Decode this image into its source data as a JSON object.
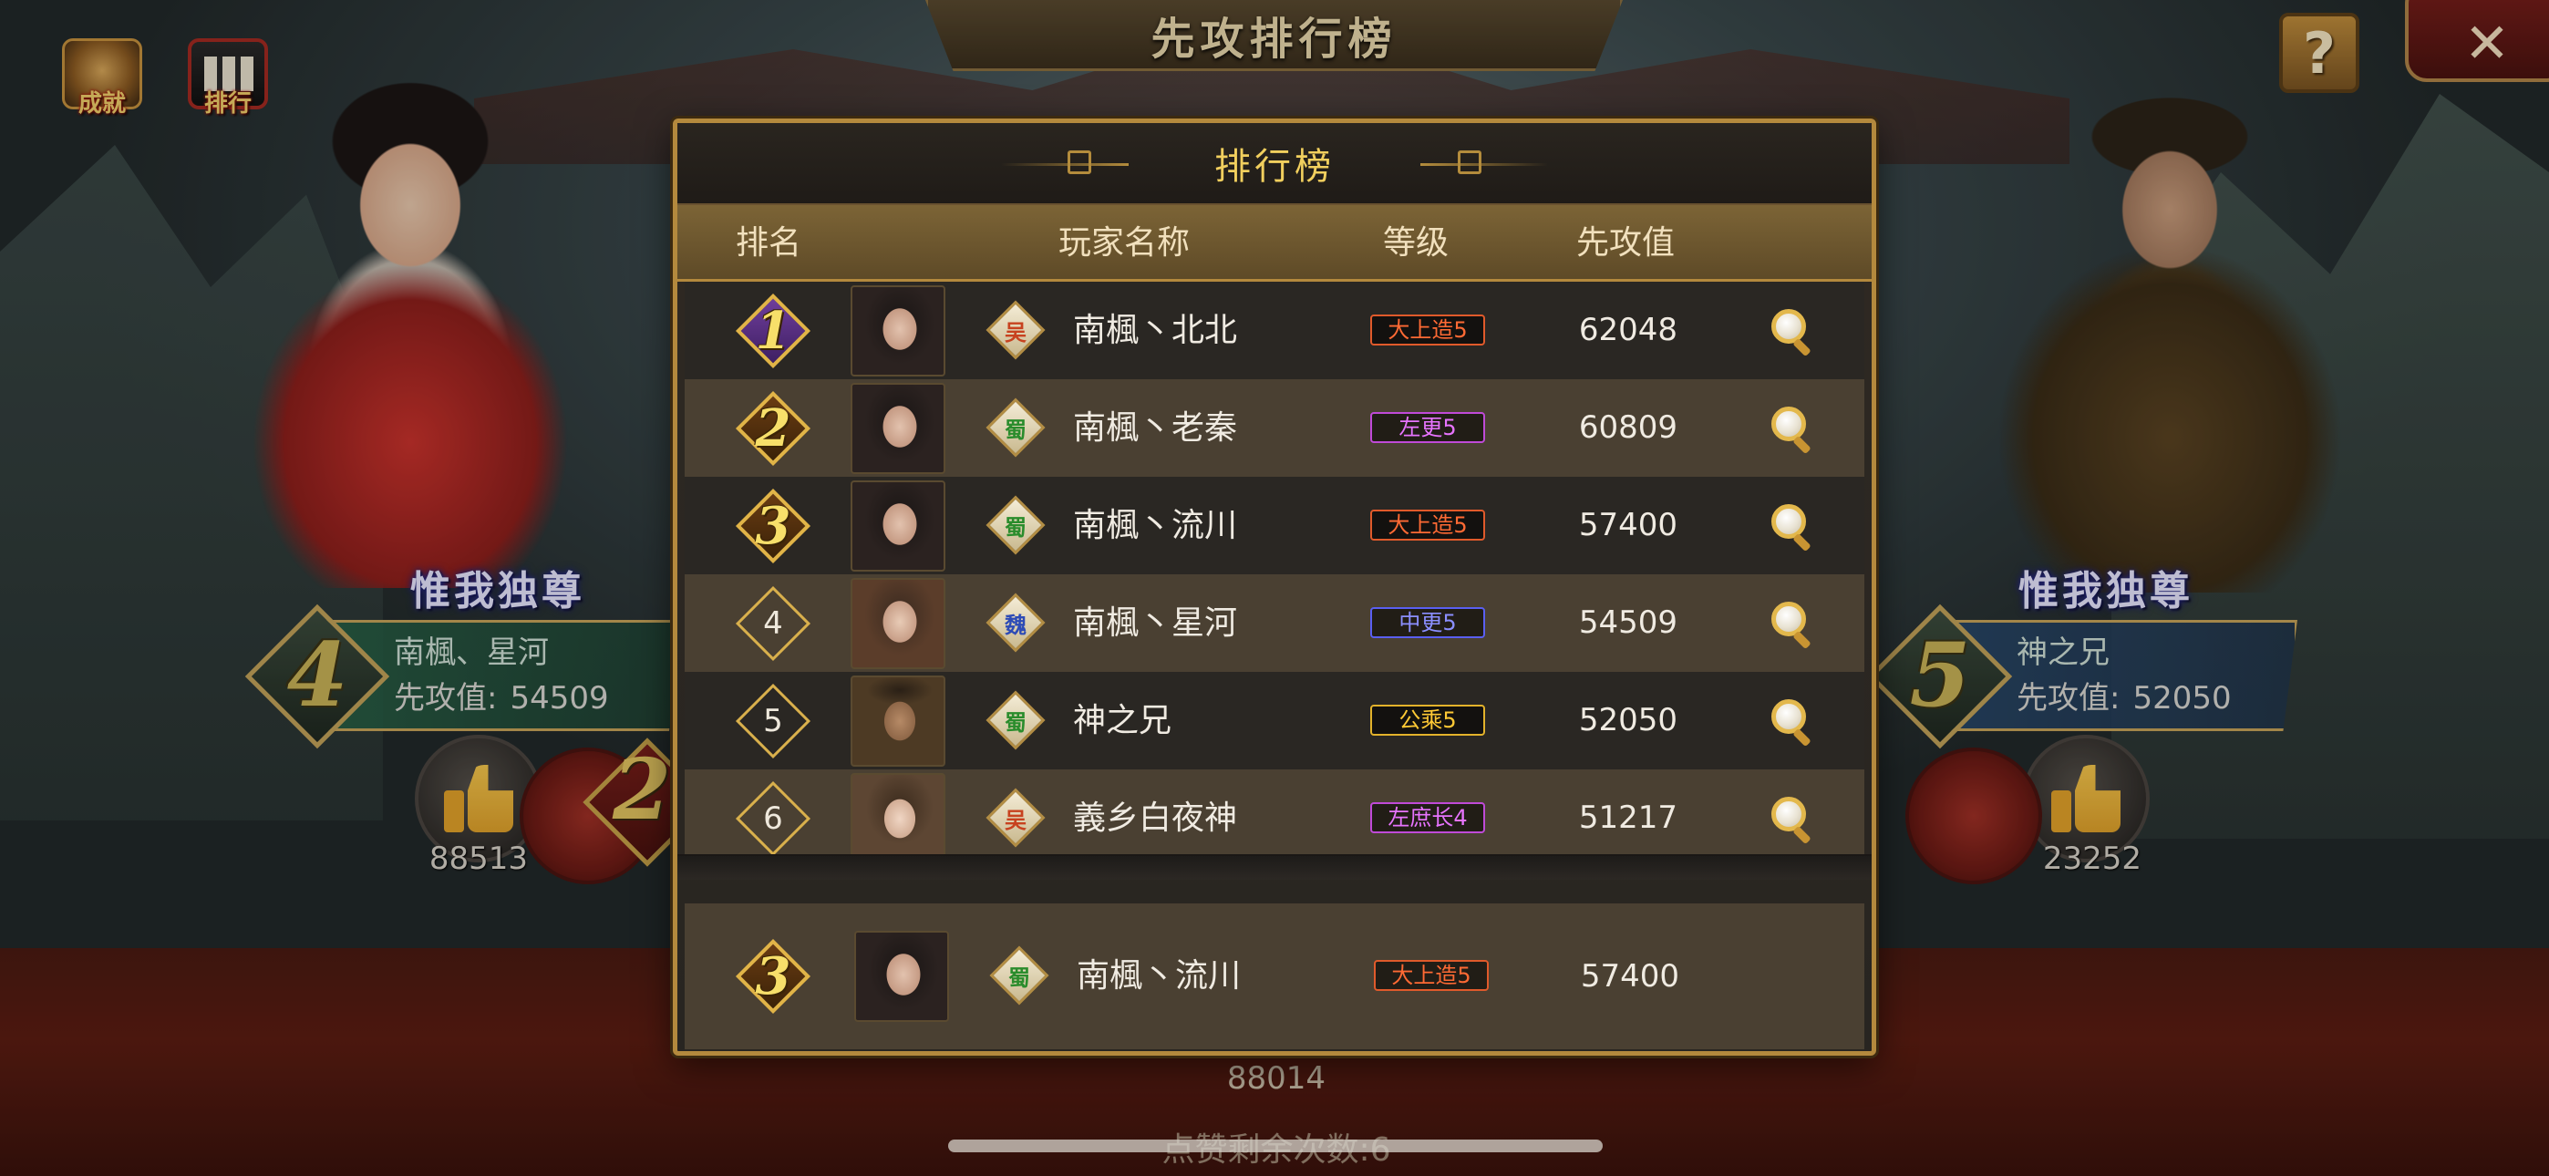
{
  "header": {
    "title": "先攻排行榜",
    "achievement_label": "成就",
    "ranking_label": "排行",
    "help_symbol": "?",
    "close_symbol": "✕"
  },
  "left_player": {
    "crown_title": "惟我独尊",
    "rank": "4",
    "name": "南楓、星河",
    "value_label": "先攻值:",
    "value": "54509",
    "likes": "88513"
  },
  "right_player": {
    "crown_title": "惟我独尊",
    "rank": "5",
    "name": "神之兄",
    "value_label": "先攻值:",
    "value": "52050",
    "likes": "23252"
  },
  "background": {
    "center_rank": "2",
    "center_likes": "88014",
    "remaining_note": "点赞剩余次数:6"
  },
  "leaderboard": {
    "title": "排行榜",
    "columns": {
      "rank": "排名",
      "player_name": "玩家名称",
      "level": "等级",
      "value": "先攻值"
    },
    "rows": [
      {
        "rank": "1",
        "kingdom": "吴",
        "name": "南楓丶北北",
        "title": "大上造5",
        "value": "62048"
      },
      {
        "rank": "2",
        "kingdom": "蜀",
        "name": "南楓丶老秦",
        "title": "左更5",
        "value": "60809"
      },
      {
        "rank": "3",
        "kingdom": "蜀",
        "name": "南楓丶流川",
        "title": "大上造5",
        "value": "57400"
      },
      {
        "rank": "4",
        "kingdom": "魏",
        "name": "南楓丶星河",
        "title": "中更5",
        "value": "54509"
      },
      {
        "rank": "5",
        "kingdom": "蜀",
        "name": "神之兄",
        "title": "公乘5",
        "value": "52050"
      },
      {
        "rank": "6",
        "kingdom": "吴",
        "name": "義乡白夜神",
        "title": "左庶长4",
        "value": "51217"
      }
    ],
    "my_rank": {
      "rank": "3",
      "kingdom": "蜀",
      "name": "南楓丶流川",
      "title": "大上造5",
      "value": "57400"
    }
  },
  "colors": {
    "accent_gold": "#b4893d",
    "title_gold": "#f1cf5e",
    "tag_red": "#ff6a34",
    "tag_purple": "#e774ff",
    "tag_blue": "#8b8fff",
    "tag_yellow": "#ffc935"
  }
}
